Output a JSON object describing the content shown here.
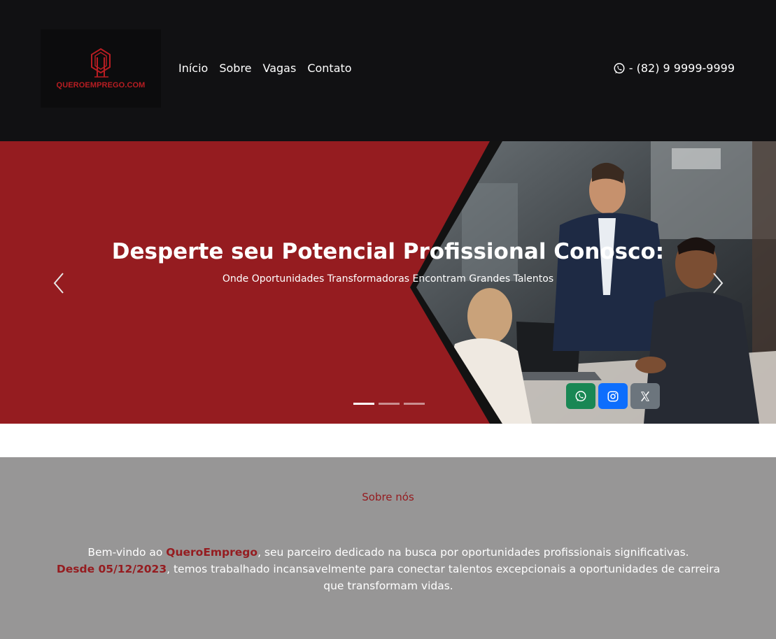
{
  "header": {
    "logo_text": "QUEROEMPREGO.COM",
    "nav": [
      "Início",
      "Sobre",
      "Vagas",
      "Contato"
    ],
    "phone": "- (82) 9 9999-9999"
  },
  "hero": {
    "title": "Desperte seu Potencial Profissional Conosco:",
    "subtitle": "Onde Oportunidades Transformadoras Encontram Grandes Talentos",
    "slide_count": 3,
    "active_slide": 1
  },
  "about": {
    "heading": "Sobre nós",
    "p1_before": "Bem-vindo ao ",
    "p1_brand": "QueroEmprego",
    "p1_after": ", seu parceiro dedicado na busca por oportunidades profissionais significativas.",
    "p2_date": "Desde 05/12/2023",
    "p2_after": ", temos trabalhado incansavelmente para conectar talentos excepcionais a oportunidades de carreira que transformam vidas."
  },
  "colors": {
    "brand_red": "#951c20",
    "header_bg": "#111113",
    "about_bg": "#979696",
    "whatsapp": "#198754",
    "instagram": "#0d6efd",
    "x": "#6c757d"
  },
  "icons": [
    "logo-q-icon",
    "whatsapp-icon",
    "chevron-left-icon",
    "chevron-right-icon",
    "instagram-icon",
    "x-icon"
  ]
}
